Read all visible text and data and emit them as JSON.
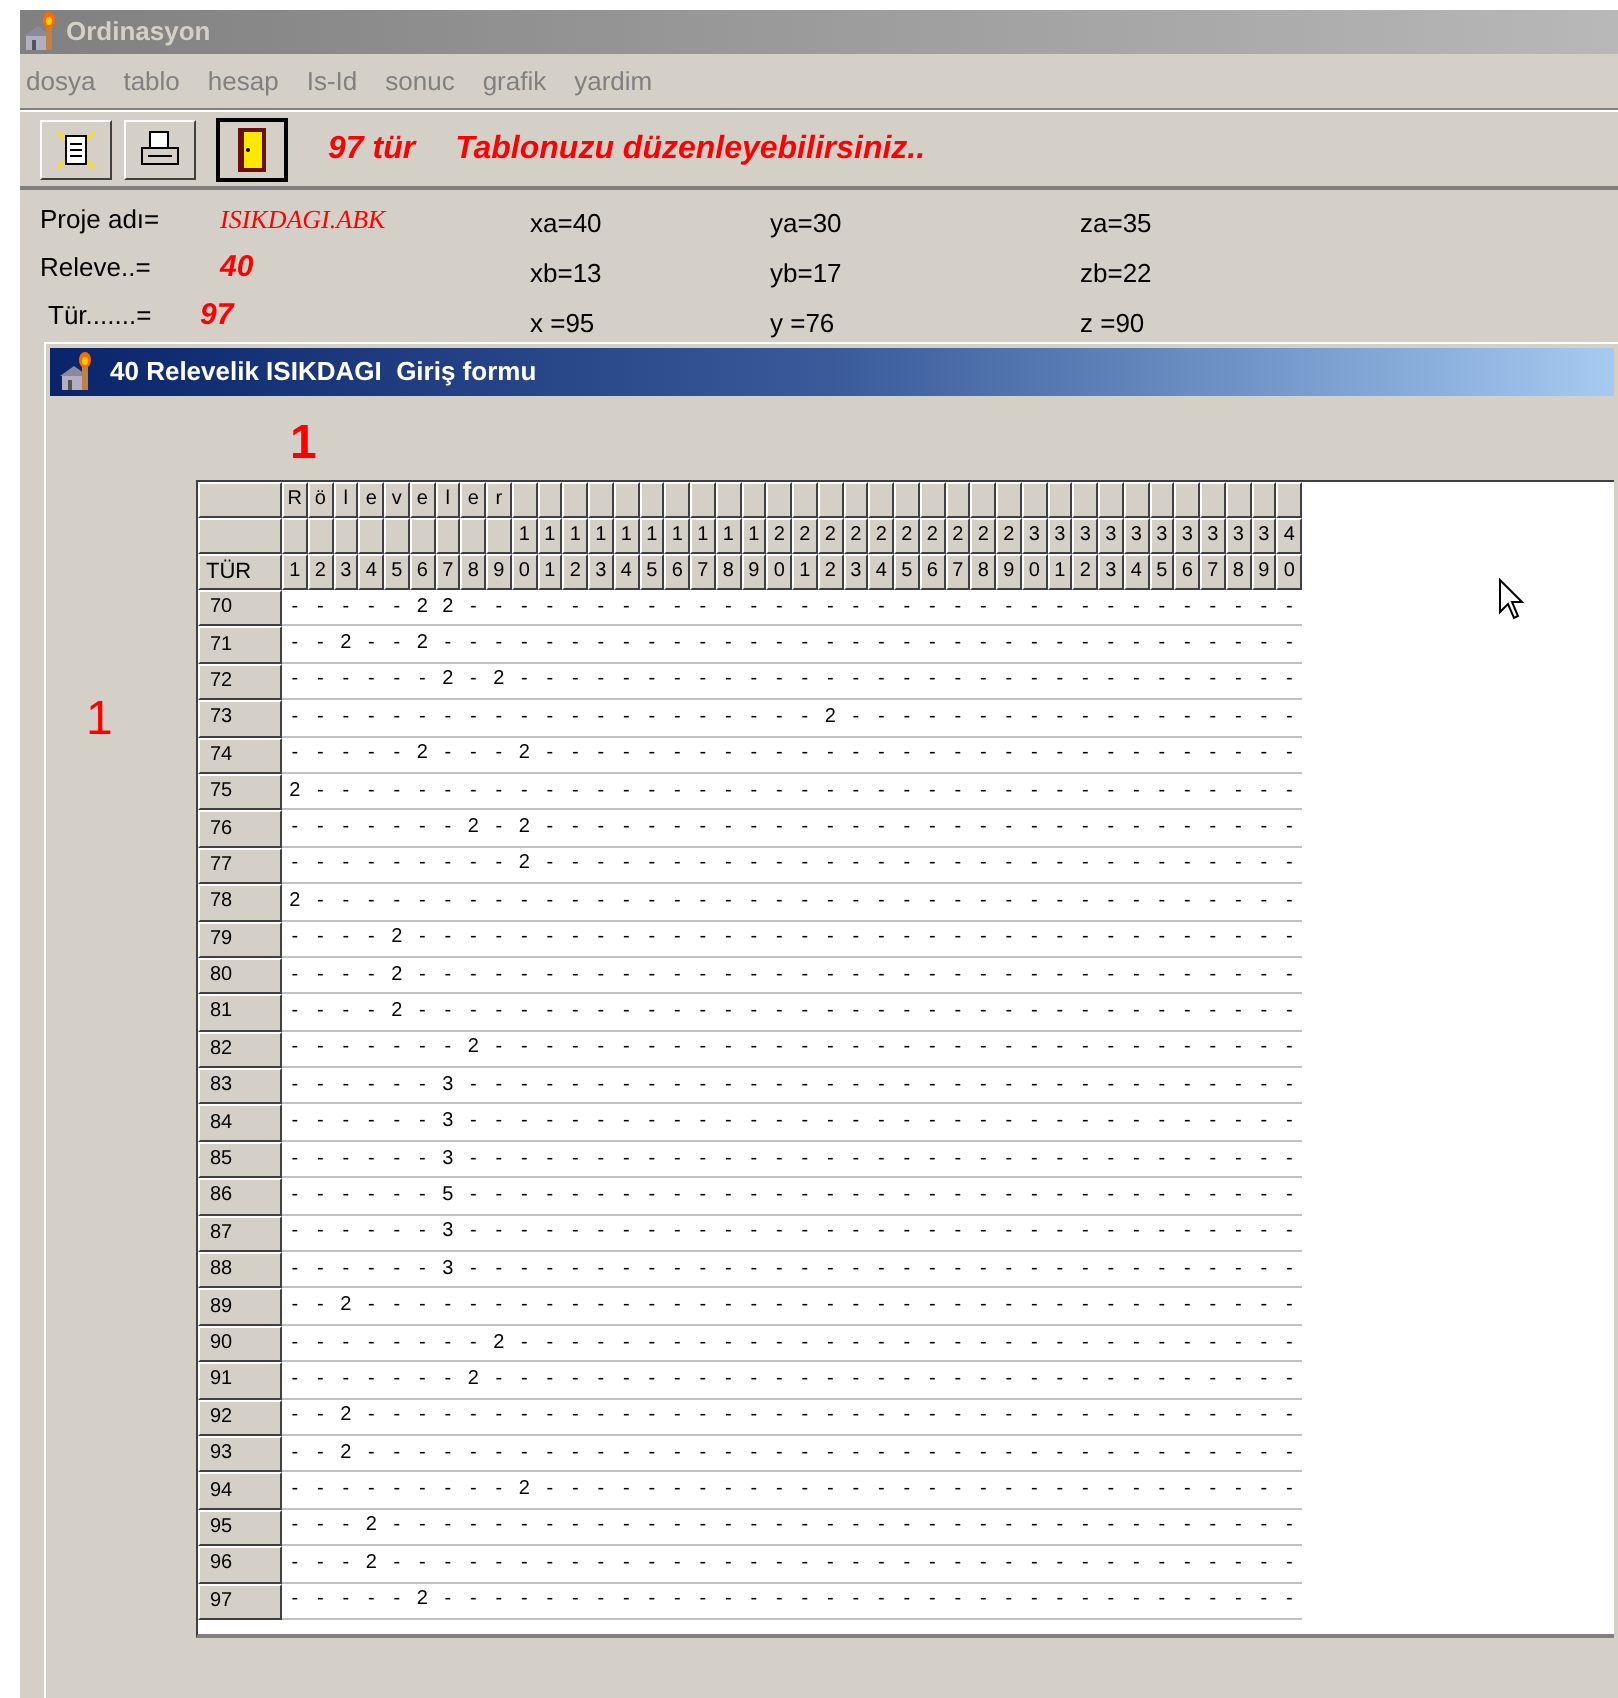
{
  "window": {
    "title": "Ordinasyon"
  },
  "menu": [
    "dosya",
    "tablo",
    "hesap",
    "Is-Id",
    "sonuc",
    "grafik",
    "yardim"
  ],
  "toolbar": {
    "count": "97 tür",
    "message": "Tablonuzu düzenleyebilirsiniz.."
  },
  "project": [
    {
      "label": "Proje adı=",
      "value": "ISIKDAGI.ABK",
      "kind": "name"
    },
    {
      "label": "Releve..=",
      "value": "40",
      "kind": "number"
    },
    {
      "label": "Tür.......=",
      "value": "97",
      "kind": "number"
    }
  ],
  "coordinates": [
    [
      "xa=40",
      "ya=30",
      "za=35"
    ],
    [
      "xb=13",
      "yb=17",
      "zb=22"
    ],
    [
      "x =95",
      "y =76",
      "z =90"
    ]
  ],
  "form": {
    "title": "40 Relevelik ISIKDAGI  Giriş formu",
    "column_marker": "1",
    "row_marker": "1",
    "grid": {
      "header_title": [
        "R",
        "ö",
        "l",
        "e",
        "v",
        "e",
        "l",
        "e",
        "r"
      ],
      "tens": [
        "1",
        "1",
        "1",
        "1",
        "1",
        "1",
        "1",
        "1",
        "1",
        "1",
        "2",
        "2",
        "2",
        "2",
        "2",
        "2",
        "2",
        "2",
        "2",
        "2",
        "3",
        "3",
        "3",
        "3",
        "3",
        "3",
        "3",
        "3",
        "3",
        "3",
        "4"
      ],
      "corner": "TÜR",
      "units": [
        "1",
        "2",
        "3",
        "4",
        "5",
        "6",
        "7",
        "8",
        "9",
        "0",
        "1",
        "2",
        "3",
        "4",
        "5",
        "6",
        "7",
        "8",
        "9",
        "0",
        "1",
        "2",
        "3",
        "4",
        "5",
        "6",
        "7",
        "8",
        "9",
        "0",
        "1",
        "2",
        "3",
        "4",
        "5",
        "6",
        "7",
        "8",
        "9",
        "0"
      ],
      "rows": [
        {
          "label": "70",
          "cells": [
            "-",
            "-",
            "-",
            "-",
            "-",
            "2",
            "2",
            "-",
            "-",
            "-",
            "-",
            "-",
            "-",
            "-",
            "-",
            "-",
            "-",
            "-",
            "-",
            "-",
            "-",
            "-",
            "-",
            "-",
            "-",
            "-",
            "-",
            "-",
            "-",
            "-",
            "-",
            "-",
            "-",
            "-",
            "-",
            "-",
            "-",
            "-",
            "-",
            "-"
          ]
        },
        {
          "label": "71",
          "cells": [
            "-",
            "-",
            "2",
            "-",
            "-",
            "2",
            "-",
            "-",
            "-",
            "-",
            "-",
            "-",
            "-",
            "-",
            "-",
            "-",
            "-",
            "-",
            "-",
            "-",
            "-",
            "-",
            "-",
            "-",
            "-",
            "-",
            "-",
            "-",
            "-",
            "-",
            "-",
            "-",
            "-",
            "-",
            "-",
            "-",
            "-",
            "-",
            "-",
            "-"
          ]
        },
        {
          "label": "72",
          "cells": [
            "-",
            "-",
            "-",
            "-",
            "-",
            "-",
            "2",
            "-",
            "2",
            "-",
            "-",
            "-",
            "-",
            "-",
            "-",
            "-",
            "-",
            "-",
            "-",
            "-",
            "-",
            "-",
            "-",
            "-",
            "-",
            "-",
            "-",
            "-",
            "-",
            "-",
            "-",
            "-",
            "-",
            "-",
            "-",
            "-",
            "-",
            "-",
            "-",
            "-"
          ]
        },
        {
          "label": "73",
          "cells": [
            "-",
            "-",
            "-",
            "-",
            "-",
            "-",
            "-",
            "-",
            "-",
            "-",
            "-",
            "-",
            "-",
            "-",
            "-",
            "-",
            "-",
            "-",
            "-",
            "-",
            "-",
            "2",
            "-",
            "-",
            "-",
            "-",
            "-",
            "-",
            "-",
            "-",
            "-",
            "-",
            "-",
            "-",
            "-",
            "-",
            "-",
            "-",
            "-",
            "-"
          ]
        },
        {
          "label": "74",
          "cells": [
            "-",
            "-",
            "-",
            "-",
            "-",
            "2",
            "-",
            "-",
            "-",
            "2",
            "-",
            "-",
            "-",
            "-",
            "-",
            "-",
            "-",
            "-",
            "-",
            "-",
            "-",
            "-",
            "-",
            "-",
            "-",
            "-",
            "-",
            "-",
            "-",
            "-",
            "-",
            "-",
            "-",
            "-",
            "-",
            "-",
            "-",
            "-",
            "-",
            "-"
          ]
        },
        {
          "label": "75",
          "cells": [
            "2",
            "-",
            "-",
            "-",
            "-",
            "-",
            "-",
            "-",
            "-",
            "-",
            "-",
            "-",
            "-",
            "-",
            "-",
            "-",
            "-",
            "-",
            "-",
            "-",
            "-",
            "-",
            "-",
            "-",
            "-",
            "-",
            "-",
            "-",
            "-",
            "-",
            "-",
            "-",
            "-",
            "-",
            "-",
            "-",
            "-",
            "-",
            "-",
            "-"
          ]
        },
        {
          "label": "76",
          "cells": [
            "-",
            "-",
            "-",
            "-",
            "-",
            "-",
            "-",
            "2",
            "-",
            "2",
            "-",
            "-",
            "-",
            "-",
            "-",
            "-",
            "-",
            "-",
            "-",
            "-",
            "-",
            "-",
            "-",
            "-",
            "-",
            "-",
            "-",
            "-",
            "-",
            "-",
            "-",
            "-",
            "-",
            "-",
            "-",
            "-",
            "-",
            "-",
            "-",
            "-"
          ]
        },
        {
          "label": "77",
          "cells": [
            "-",
            "-",
            "-",
            "-",
            "-",
            "-",
            "-",
            "-",
            "-",
            "2",
            "-",
            "-",
            "-",
            "-",
            "-",
            "-",
            "-",
            "-",
            "-",
            "-",
            "-",
            "-",
            "-",
            "-",
            "-",
            "-",
            "-",
            "-",
            "-",
            "-",
            "-",
            "-",
            "-",
            "-",
            "-",
            "-",
            "-",
            "-",
            "-",
            "-"
          ]
        },
        {
          "label": "78",
          "cells": [
            "2",
            "-",
            "-",
            "-",
            "-",
            "-",
            "-",
            "-",
            "-",
            "-",
            "-",
            "-",
            "-",
            "-",
            "-",
            "-",
            "-",
            "-",
            "-",
            "-",
            "-",
            "-",
            "-",
            "-",
            "-",
            "-",
            "-",
            "-",
            "-",
            "-",
            "-",
            "-",
            "-",
            "-",
            "-",
            "-",
            "-",
            "-",
            "-",
            "-"
          ]
        },
        {
          "label": "79",
          "cells": [
            "-",
            "-",
            "-",
            "-",
            "2",
            "-",
            "-",
            "-",
            "-",
            "-",
            "-",
            "-",
            "-",
            "-",
            "-",
            "-",
            "-",
            "-",
            "-",
            "-",
            "-",
            "-",
            "-",
            "-",
            "-",
            "-",
            "-",
            "-",
            "-",
            "-",
            "-",
            "-",
            "-",
            "-",
            "-",
            "-",
            "-",
            "-",
            "-",
            "-"
          ]
        },
        {
          "label": "80",
          "cells": [
            "-",
            "-",
            "-",
            "-",
            "2",
            "-",
            "-",
            "-",
            "-",
            "-",
            "-",
            "-",
            "-",
            "-",
            "-",
            "-",
            "-",
            "-",
            "-",
            "-",
            "-",
            "-",
            "-",
            "-",
            "-",
            "-",
            "-",
            "-",
            "-",
            "-",
            "-",
            "-",
            "-",
            "-",
            "-",
            "-",
            "-",
            "-",
            "-",
            "-"
          ]
        },
        {
          "label": "81",
          "cells": [
            "-",
            "-",
            "-",
            "-",
            "2",
            "-",
            "-",
            "-",
            "-",
            "-",
            "-",
            "-",
            "-",
            "-",
            "-",
            "-",
            "-",
            "-",
            "-",
            "-",
            "-",
            "-",
            "-",
            "-",
            "-",
            "-",
            "-",
            "-",
            "-",
            "-",
            "-",
            "-",
            "-",
            "-",
            "-",
            "-",
            "-",
            "-",
            "-",
            "-"
          ]
        },
        {
          "label": "82",
          "cells": [
            "-",
            "-",
            "-",
            "-",
            "-",
            "-",
            "-",
            "2",
            "-",
            "-",
            "-",
            "-",
            "-",
            "-",
            "-",
            "-",
            "-",
            "-",
            "-",
            "-",
            "-",
            "-",
            "-",
            "-",
            "-",
            "-",
            "-",
            "-",
            "-",
            "-",
            "-",
            "-",
            "-",
            "-",
            "-",
            "-",
            "-",
            "-",
            "-",
            "-"
          ]
        },
        {
          "label": "83",
          "cells": [
            "-",
            "-",
            "-",
            "-",
            "-",
            "-",
            "3",
            "-",
            "-",
            "-",
            "-",
            "-",
            "-",
            "-",
            "-",
            "-",
            "-",
            "-",
            "-",
            "-",
            "-",
            "-",
            "-",
            "-",
            "-",
            "-",
            "-",
            "-",
            "-",
            "-",
            "-",
            "-",
            "-",
            "-",
            "-",
            "-",
            "-",
            "-",
            "-",
            "-"
          ]
        },
        {
          "label": "84",
          "cells": [
            "-",
            "-",
            "-",
            "-",
            "-",
            "-",
            "3",
            "-",
            "-",
            "-",
            "-",
            "-",
            "-",
            "-",
            "-",
            "-",
            "-",
            "-",
            "-",
            "-",
            "-",
            "-",
            "-",
            "-",
            "-",
            "-",
            "-",
            "-",
            "-",
            "-",
            "-",
            "-",
            "-",
            "-",
            "-",
            "-",
            "-",
            "-",
            "-",
            "-"
          ]
        },
        {
          "label": "85",
          "cells": [
            "-",
            "-",
            "-",
            "-",
            "-",
            "-",
            "3",
            "-",
            "-",
            "-",
            "-",
            "-",
            "-",
            "-",
            "-",
            "-",
            "-",
            "-",
            "-",
            "-",
            "-",
            "-",
            "-",
            "-",
            "-",
            "-",
            "-",
            "-",
            "-",
            "-",
            "-",
            "-",
            "-",
            "-",
            "-",
            "-",
            "-",
            "-",
            "-",
            "-"
          ]
        },
        {
          "label": "86",
          "cells": [
            "-",
            "-",
            "-",
            "-",
            "-",
            "-",
            "5",
            "-",
            "-",
            "-",
            "-",
            "-",
            "-",
            "-",
            "-",
            "-",
            "-",
            "-",
            "-",
            "-",
            "-",
            "-",
            "-",
            "-",
            "-",
            "-",
            "-",
            "-",
            "-",
            "-",
            "-",
            "-",
            "-",
            "-",
            "-",
            "-",
            "-",
            "-",
            "-",
            "-"
          ]
        },
        {
          "label": "87",
          "cells": [
            "-",
            "-",
            "-",
            "-",
            "-",
            "-",
            "3",
            "-",
            "-",
            "-",
            "-",
            "-",
            "-",
            "-",
            "-",
            "-",
            "-",
            "-",
            "-",
            "-",
            "-",
            "-",
            "-",
            "-",
            "-",
            "-",
            "-",
            "-",
            "-",
            "-",
            "-",
            "-",
            "-",
            "-",
            "-",
            "-",
            "-",
            "-",
            "-",
            "-"
          ]
        },
        {
          "label": "88",
          "cells": [
            "-",
            "-",
            "-",
            "-",
            "-",
            "-",
            "3",
            "-",
            "-",
            "-",
            "-",
            "-",
            "-",
            "-",
            "-",
            "-",
            "-",
            "-",
            "-",
            "-",
            "-",
            "-",
            "-",
            "-",
            "-",
            "-",
            "-",
            "-",
            "-",
            "-",
            "-",
            "-",
            "-",
            "-",
            "-",
            "-",
            "-",
            "-",
            "-",
            "-"
          ]
        },
        {
          "label": "89",
          "cells": [
            "-",
            "-",
            "2",
            "-",
            "-",
            "-",
            "-",
            "-",
            "-",
            "-",
            "-",
            "-",
            "-",
            "-",
            "-",
            "-",
            "-",
            "-",
            "-",
            "-",
            "-",
            "-",
            "-",
            "-",
            "-",
            "-",
            "-",
            "-",
            "-",
            "-",
            "-",
            "-",
            "-",
            "-",
            "-",
            "-",
            "-",
            "-",
            "-",
            "-"
          ]
        },
        {
          "label": "90",
          "cells": [
            "-",
            "-",
            "-",
            "-",
            "-",
            "-",
            "-",
            "-",
            "2",
            "-",
            "-",
            "-",
            "-",
            "-",
            "-",
            "-",
            "-",
            "-",
            "-",
            "-",
            "-",
            "-",
            "-",
            "-",
            "-",
            "-",
            "-",
            "-",
            "-",
            "-",
            "-",
            "-",
            "-",
            "-",
            "-",
            "-",
            "-",
            "-",
            "-",
            "-"
          ]
        },
        {
          "label": "91",
          "cells": [
            "-",
            "-",
            "-",
            "-",
            "-",
            "-",
            "-",
            "2",
            "-",
            "-",
            "-",
            "-",
            "-",
            "-",
            "-",
            "-",
            "-",
            "-",
            "-",
            "-",
            "-",
            "-",
            "-",
            "-",
            "-",
            "-",
            "-",
            "-",
            "-",
            "-",
            "-",
            "-",
            "-",
            "-",
            "-",
            "-",
            "-",
            "-",
            "-",
            "-"
          ]
        },
        {
          "label": "92",
          "cells": [
            "-",
            "-",
            "2",
            "-",
            "-",
            "-",
            "-",
            "-",
            "-",
            "-",
            "-",
            "-",
            "-",
            "-",
            "-",
            "-",
            "-",
            "-",
            "-",
            "-",
            "-",
            "-",
            "-",
            "-",
            "-",
            "-",
            "-",
            "-",
            "-",
            "-",
            "-",
            "-",
            "-",
            "-",
            "-",
            "-",
            "-",
            "-",
            "-",
            "-"
          ]
        },
        {
          "label": "93",
          "cells": [
            "-",
            "-",
            "2",
            "-",
            "-",
            "-",
            "-",
            "-",
            "-",
            "-",
            "-",
            "-",
            "-",
            "-",
            "-",
            "-",
            "-",
            "-",
            "-",
            "-",
            "-",
            "-",
            "-",
            "-",
            "-",
            "-",
            "-",
            "-",
            "-",
            "-",
            "-",
            "-",
            "-",
            "-",
            "-",
            "-",
            "-",
            "-",
            "-",
            "-"
          ]
        },
        {
          "label": "94",
          "cells": [
            "-",
            "-",
            "-",
            "-",
            "-",
            "-",
            "-",
            "-",
            "-",
            "2",
            "-",
            "-",
            "-",
            "-",
            "-",
            "-",
            "-",
            "-",
            "-",
            "-",
            "-",
            "-",
            "-",
            "-",
            "-",
            "-",
            "-",
            "-",
            "-",
            "-",
            "-",
            "-",
            "-",
            "-",
            "-",
            "-",
            "-",
            "-",
            "-",
            "-"
          ]
        },
        {
          "label": "95",
          "cells": [
            "-",
            "-",
            "-",
            "2",
            "-",
            "-",
            "-",
            "-",
            "-",
            "-",
            "-",
            "-",
            "-",
            "-",
            "-",
            "-",
            "-",
            "-",
            "-",
            "-",
            "-",
            "-",
            "-",
            "-",
            "-",
            "-",
            "-",
            "-",
            "-",
            "-",
            "-",
            "-",
            "-",
            "-",
            "-",
            "-",
            "-",
            "-",
            "-",
            "-"
          ]
        },
        {
          "label": "96",
          "cells": [
            "-",
            "-",
            "-",
            "2",
            "-",
            "-",
            "-",
            "-",
            "-",
            "-",
            "-",
            "-",
            "-",
            "-",
            "-",
            "-",
            "-",
            "-",
            "-",
            "-",
            "-",
            "-",
            "-",
            "-",
            "-",
            "-",
            "-",
            "-",
            "-",
            "-",
            "-",
            "-",
            "-",
            "-",
            "-",
            "-",
            "-",
            "-",
            "-",
            "-"
          ]
        },
        {
          "label": "97",
          "cells": [
            "-",
            "-",
            "-",
            "-",
            "-",
            "2",
            "-",
            "-",
            "-",
            "-",
            "-",
            "-",
            "-",
            "-",
            "-",
            "-",
            "-",
            "-",
            "-",
            "-",
            "-",
            "-",
            "-",
            "-",
            "-",
            "-",
            "-",
            "-",
            "-",
            "-",
            "-",
            "-",
            "-",
            "-",
            "-",
            "-",
            "-",
            "-",
            "-",
            "-"
          ]
        }
      ]
    }
  }
}
